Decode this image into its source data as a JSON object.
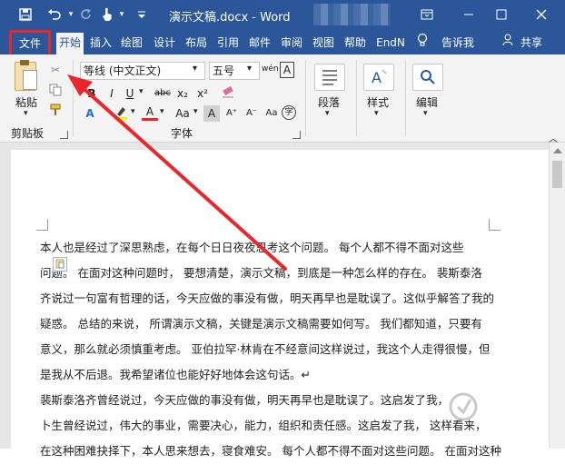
{
  "titlebar": {
    "title": "演示文稿.docx  -  Word",
    "quick_access": [
      "save-icon",
      "undo-icon",
      "redo-icon",
      "touch-icon",
      "customize-icon"
    ],
    "window_controls": [
      "ribbon-display-icon",
      "minimize-icon",
      "maximize-icon",
      "close-icon"
    ]
  },
  "tabs": {
    "file": "文件",
    "home": "开始",
    "insert": "插入",
    "draw": "绘图",
    "design": "设计",
    "layout": "布局",
    "references": "引用",
    "mailings": "邮件",
    "review": "审阅",
    "view": "视图",
    "help": "帮助",
    "endnote": "EndN",
    "tellme": "告诉我",
    "share": "共享"
  },
  "ribbon": {
    "clipboard": {
      "paste": "粘贴",
      "label": "剪贴板"
    },
    "font": {
      "font_name": "等线 (中文正文)",
      "font_size": "五号",
      "label": "字体",
      "buttons": [
        "B",
        "I",
        "U",
        "abc",
        "x₂",
        "x²",
        "A",
        "Aa"
      ]
    },
    "paragraph": {
      "label": "段落"
    },
    "styles": {
      "label": "样式"
    },
    "editing": {
      "label": "编辑"
    }
  },
  "document": {
    "lines": [
      "本人也是经过了深思熟虑，在每个日日夜夜思考这个问题。 每个人都不得不面对这些",
      "问题。 在面对这种问题时，  要想清楚，演示文稿，到底是一种怎么样的存在。 裴斯泰洛",
      "齐说过一句富有哲理的话，今天应做的事没有做，明天再早也是耽误了。这似乎解答了我的",
      "疑惑。  总结的来说，  所谓演示文稿，关键是演示文稿需要如何写。 我们都知道，只要有",
      "意义，那么就必须慎重考虑。  亚伯拉罕·林肯在不经意间这样说过，我这个人走得很慢，但",
      "是我从不后退。我希望诸位也能好好地体会这句话。↵",
      "    裴斯泰洛齐曾经说过，今天应做的事没有做，明天再早也是耽误了。这启发了我，  ",
      "卜生曾经说过，伟大的事业，需要决心，能力，组织和责任感。这启发了我，  这样看来，",
      "在这种困难抉择下，本人思来想去，寝食难安。  每个人都不得不面对这些问题。 在面对这种"
    ]
  },
  "colors": {
    "accent": "#2b579a",
    "highlight": "#e8262b"
  }
}
